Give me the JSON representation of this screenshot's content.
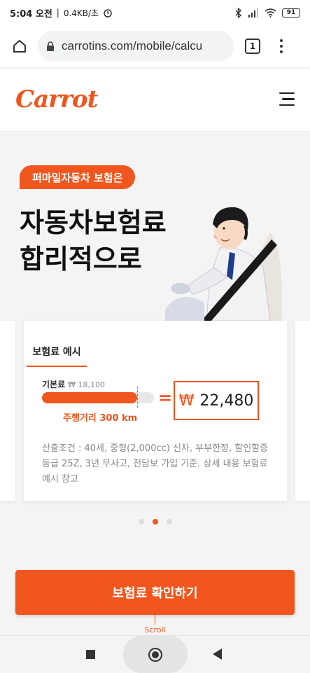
{
  "status_bar": {
    "time": "5:04 오전",
    "net_speed": "0.4KB/초",
    "battery": "91"
  },
  "browser": {
    "url": "carrotins.com/mobile/calcu",
    "tab_count": "1"
  },
  "header": {
    "logo": "Carrot"
  },
  "hero": {
    "badge": "퍼마일자동차 보험은",
    "title_line1": "자동차보험료",
    "title_line2": "합리적으로"
  },
  "card": {
    "tab_label": "보험료 예시",
    "base_label": "기본료",
    "base_price": "₩ 18,100",
    "mileage_label": "주행거리 300 km",
    "equals": "=",
    "currency": "₩",
    "price": "22,480",
    "mileage_fill_fraction": 0.85,
    "description": "산출조건 : 40세, 중형(2,000cc) 신차, 부부한정, 할인할증등급 25Z, 3년 무사고, 전담보 가입 기준. 상세 내용 보험료 예시 참고"
  },
  "carousel": {
    "active_index": 1,
    "count": 3
  },
  "cta": {
    "label": "보험료 확인하기"
  },
  "scroll_hint": "Scroll",
  "colors": {
    "accent": "#f0561e"
  }
}
